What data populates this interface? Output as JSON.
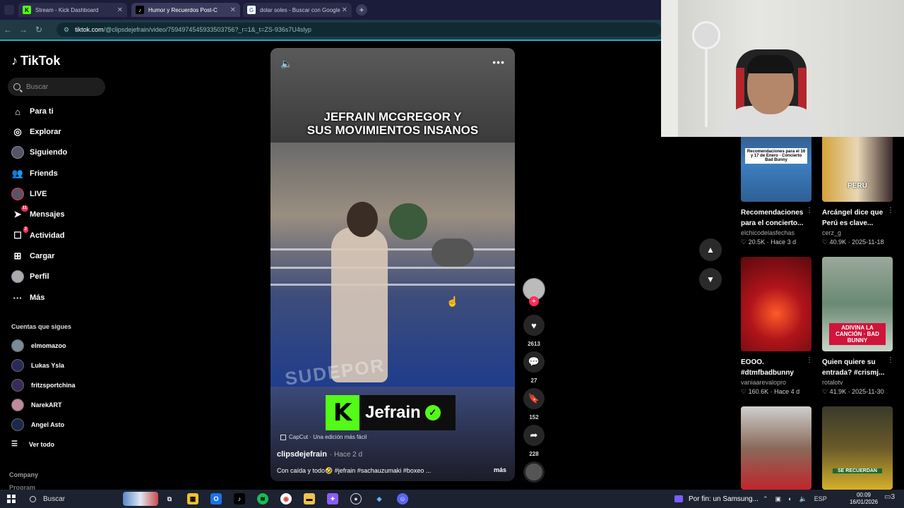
{
  "browser": {
    "tabs": [
      {
        "title": "Stream - Kick Dashboard",
        "favicon": "K"
      },
      {
        "title": "Humor y Recuerdos Post-C",
        "favicon": "♪"
      },
      {
        "title": "dolar soles - Buscar con Google",
        "favicon": "G"
      }
    ],
    "url_host": "tiktok.com",
    "url_path": "/@clipsdejefrain/video/7594974545933503756?_r=1&_t=ZS-936s7U4slyp"
  },
  "sidebar": {
    "logo": "TikTok",
    "search_placeholder": "Buscar",
    "nav": [
      {
        "label": "Para ti",
        "icon": "home-icon"
      },
      {
        "label": "Explorar",
        "icon": "compass-icon"
      },
      {
        "label": "Siguiendo",
        "icon": "following-avatar-icon"
      },
      {
        "label": "Friends",
        "icon": "friends-icon"
      },
      {
        "label": "LIVE",
        "icon": "live-icon"
      },
      {
        "label": "Mensajes",
        "icon": "messages-icon",
        "badge": "11"
      },
      {
        "label": "Actividad",
        "icon": "activity-icon",
        "badge": "2"
      },
      {
        "label": "Cargar",
        "icon": "upload-icon"
      },
      {
        "label": "Perfil",
        "icon": "profile-icon"
      },
      {
        "label": "Más",
        "icon": "more-icon"
      }
    ],
    "following_title": "Cuentas que sigues",
    "following": [
      "elmomazoo",
      "Lukas Ysla",
      "fritzsportchina",
      "NarekART",
      "Angel Asto"
    ],
    "see_all": "Ver todo",
    "company": "Company",
    "program": "Program"
  },
  "video": {
    "title_line1": "JEFRAIN MCGREGOR Y",
    "title_line2": "SUS MOVIMIENTOS INSANOS",
    "watermark_name": "Jefrain",
    "capcut": "CapCut · Una edición más fácil",
    "author": "clipsdejefrain",
    "ago": "· Hace 2 d",
    "caption": "Con caída y todo🤣 #jefrain #sachauzumaki #boxeo ...",
    "more": "más",
    "likes": "2613",
    "comments": "27",
    "saves": "152",
    "shares": "228"
  },
  "recommendations": [
    {
      "title": "Recomendaciones para el concierto...",
      "user": "elchicodelasfechas",
      "likes": "20.5K",
      "when": "Hace 3 d",
      "overlay": "Recomendaciones para el 16 y 17 de Enero · Concierto Bad Bunny",
      "color": "#3d7fc0"
    },
    {
      "title": "Arcángel dice que Perú es clave...",
      "user": "cerz_g",
      "likes": "40.9K",
      "when": "2025-11-18",
      "overlay": "PERÚ",
      "color": "#d4a23a"
    },
    {
      "title": "EOOO. #dtmfbadbunny",
      "user": "vaniaarevalopro",
      "likes": "160.6K",
      "when": "Hace 4 d",
      "overlay": "",
      "color": "#b0141a"
    },
    {
      "title": "Quien quiere su entrada? #crismj...",
      "user": "rotalotv",
      "likes": "41.9K",
      "when": "2025-11-30",
      "overlay": "ADIVINA LA CANCIÓN · BAD BUNNY",
      "color": "#6a8a74"
    },
    {
      "title": "",
      "user": "",
      "likes": "",
      "when": "",
      "overlay": "",
      "color": "#8a6a5a"
    },
    {
      "title": "",
      "user": "",
      "likes": "",
      "when": "",
      "overlay": "SE RECUERDAN",
      "color": "#6a5a2a"
    }
  ],
  "taskbar": {
    "search": "Buscar",
    "media": "Por fin: un Samsung...",
    "lang": "ESP",
    "time": "00:09",
    "date": "16/01/2026",
    "notif_count": "3"
  }
}
